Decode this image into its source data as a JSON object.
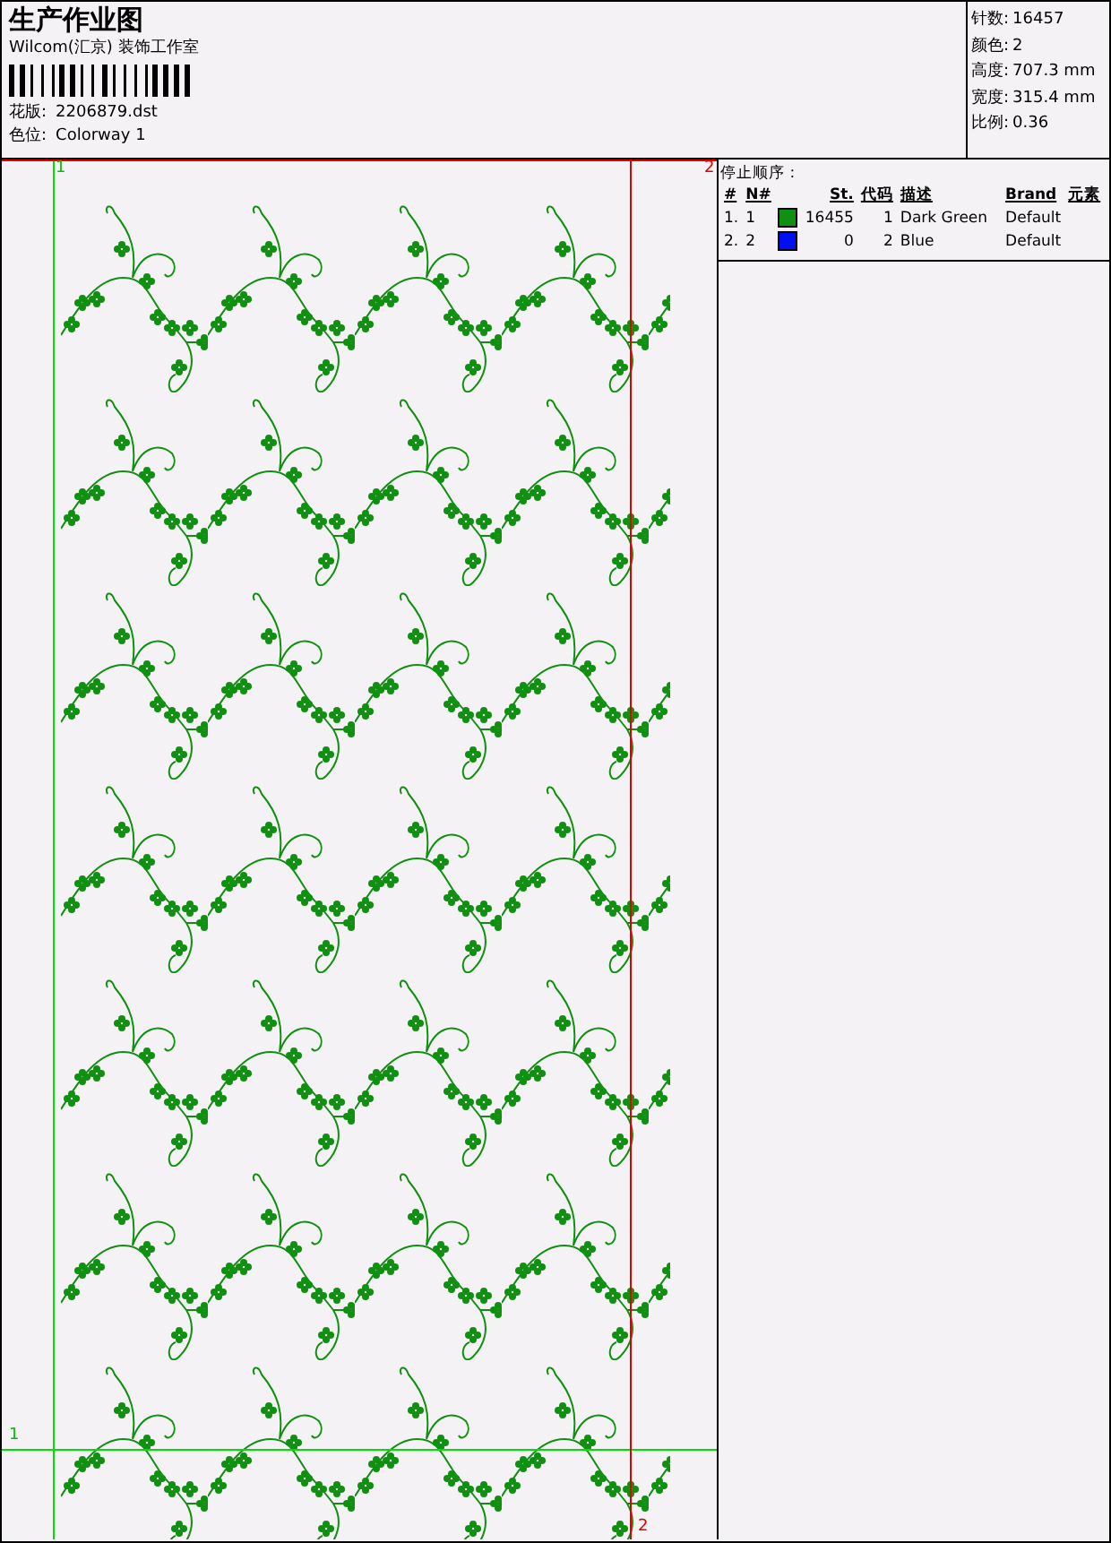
{
  "header": {
    "title": "生产作业图",
    "company": "Wilcom(汇京) 装饰工作室",
    "design_label": "花版:",
    "design_file": "2206879.dst",
    "colorway_label": "色位:",
    "colorway": "Colorway 1"
  },
  "info": [
    {
      "label": "针数:",
      "value": "16457"
    },
    {
      "label": "颜色:",
      "value": "2"
    },
    {
      "label": "高度:",
      "value": "707.3 mm"
    },
    {
      "label": "宽度:",
      "value": "315.4 mm"
    },
    {
      "label": "比例:",
      "value": "0.36"
    }
  ],
  "stop_sequence": {
    "title": "停止顺序 :",
    "columns": [
      "#",
      "N#",
      "St.",
      "代码",
      "描述",
      "Brand",
      "元素"
    ],
    "rows": [
      {
        "index": "1.",
        "number": "1",
        "color": "#109010",
        "stitches": "16455",
        "code": "1",
        "description": "Dark Green",
        "brand": "Default"
      },
      {
        "index": "2.",
        "number": "2",
        "color": "#0010f0",
        "stitches": "0",
        "code": "2",
        "description": "Blue",
        "brand": "Default"
      }
    ]
  },
  "design": {
    "markers": [
      {
        "label": "1",
        "kind": "start"
      },
      {
        "label": "2",
        "kind": "end"
      },
      {
        "label": "1",
        "kind": "start-bottom"
      },
      {
        "label": "2",
        "kind": "end-bottom"
      }
    ]
  }
}
